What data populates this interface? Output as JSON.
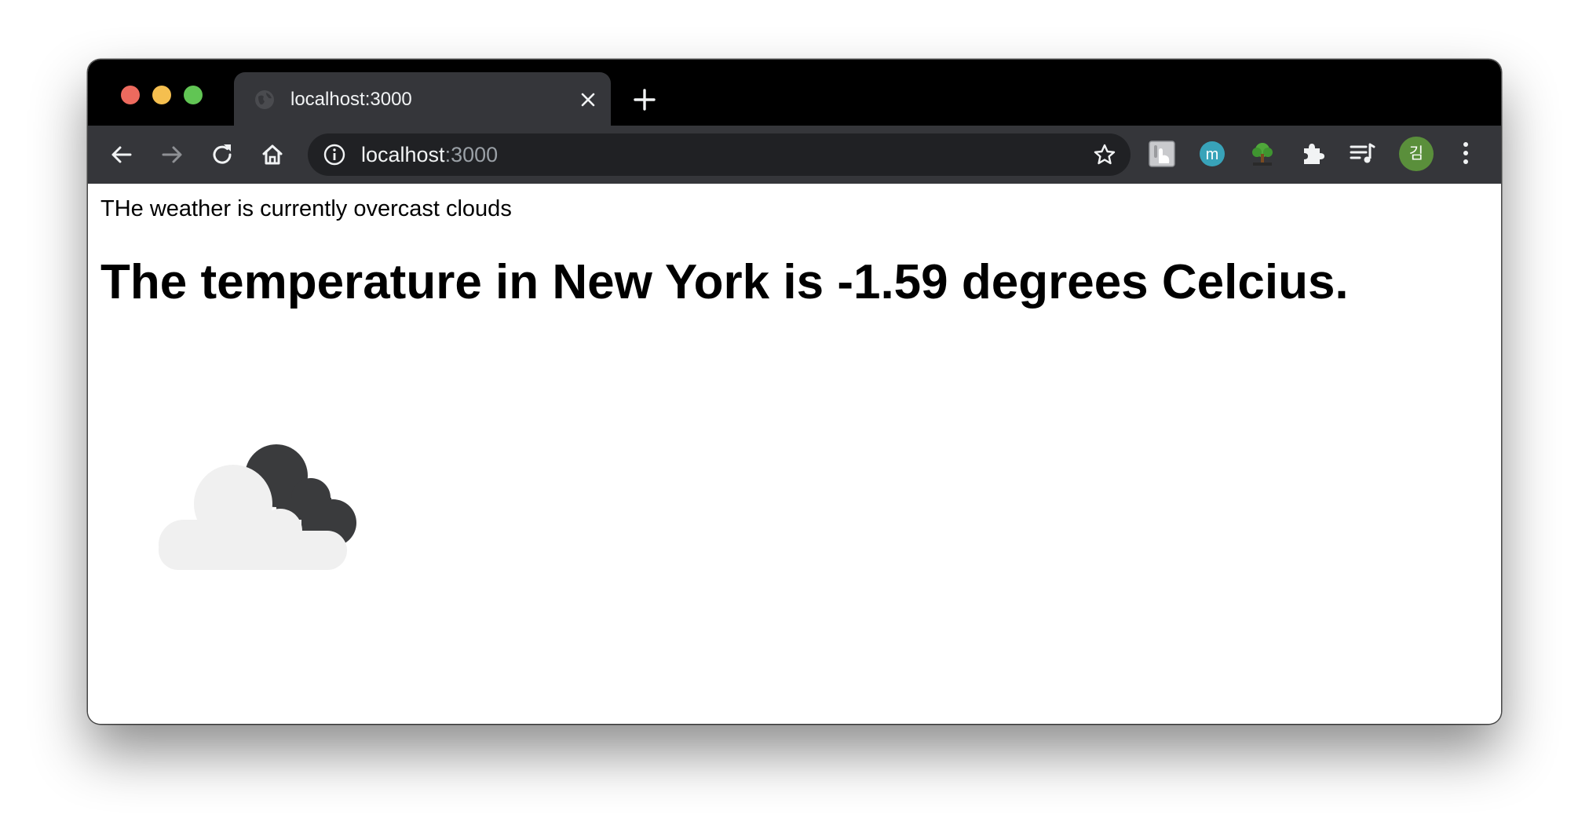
{
  "browser": {
    "tab": {
      "title": "localhost:3000",
      "favicon": "globe-icon"
    },
    "address": {
      "host": "localhost",
      "port": ":3000"
    },
    "extensions": [
      "touch-extension-icon",
      "m-extension-icon",
      "tree-extension-icon",
      "puzzle-icon",
      "media-queue-icon"
    ],
    "profile": {
      "initial": "김",
      "color": "#5a8f3b"
    }
  },
  "page": {
    "weather_text": "THe weather is currently overcast clouds",
    "temperature_heading": "The temperature in New York is -1.59 degrees Celcius.",
    "weather_icon": "overcast-clouds-icon"
  },
  "colors": {
    "traffic_red": "#ed6a5e",
    "traffic_yellow": "#f5bf4f",
    "traffic_green": "#61c554",
    "chrome_dark": "#35363a",
    "omnibox": "#202124"
  }
}
